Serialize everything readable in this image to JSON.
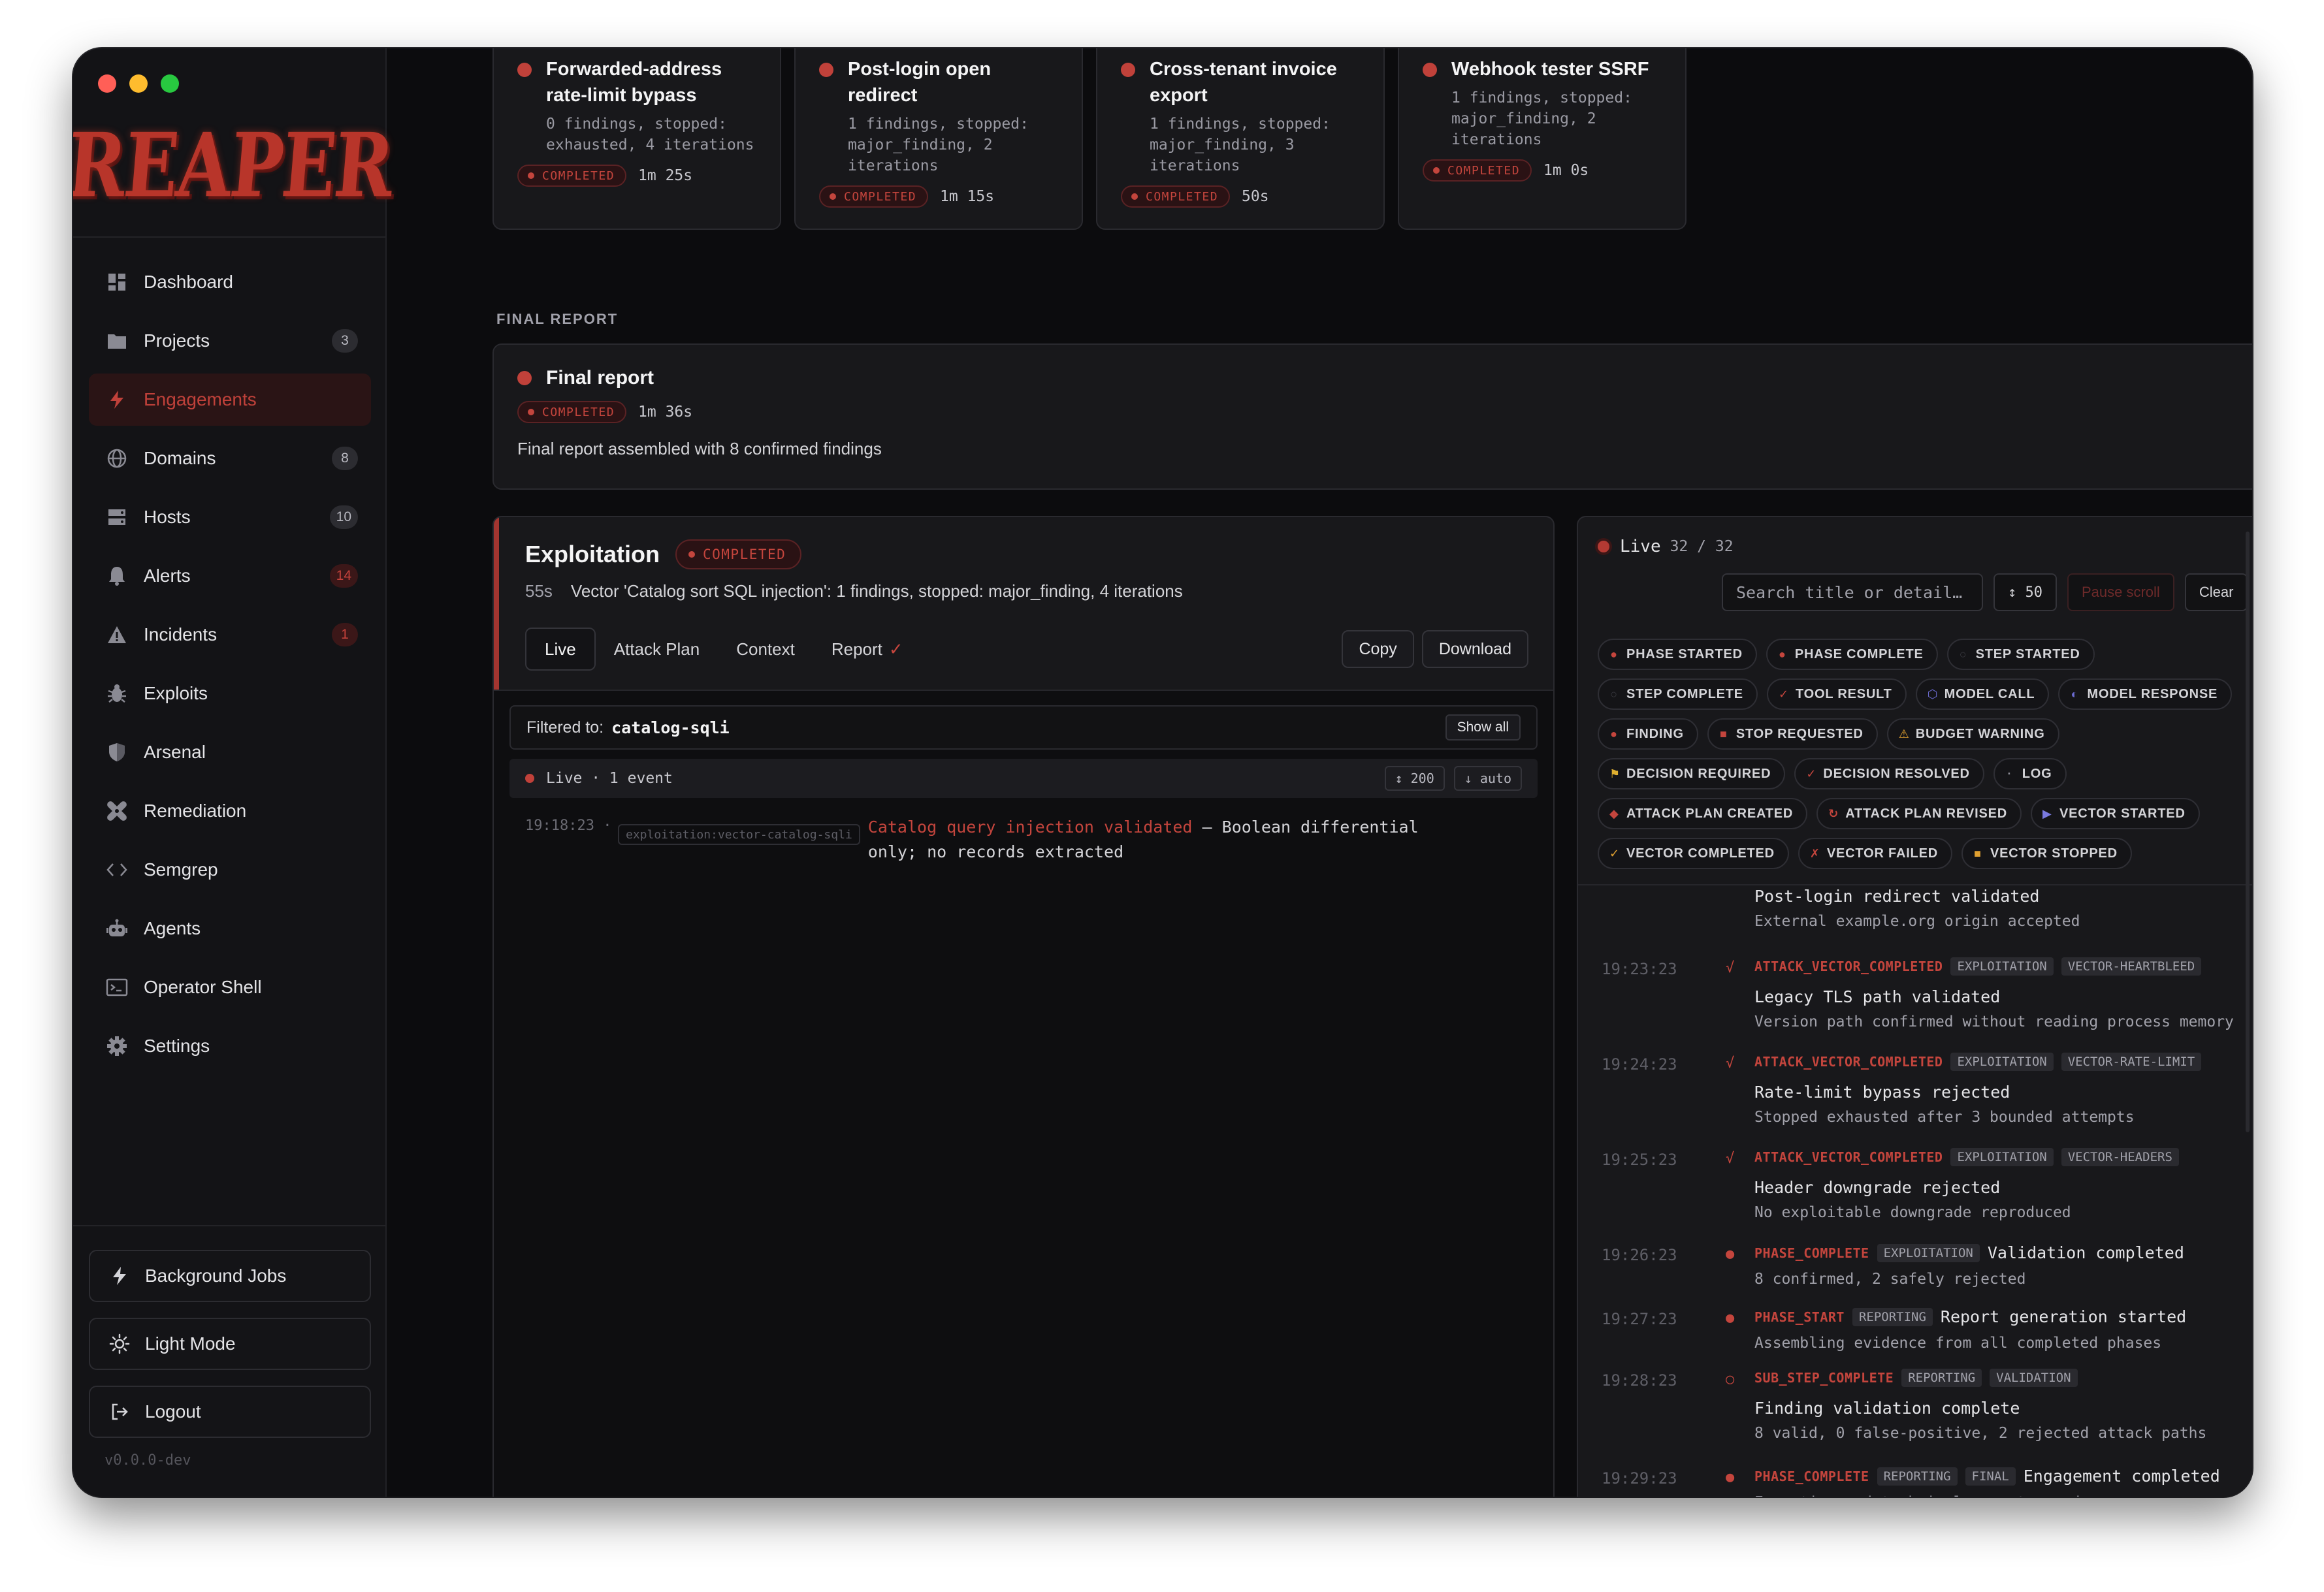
{
  "window": {
    "traffic_colors": [
      "#ff5f57",
      "#febc2e",
      "#28c840"
    ]
  },
  "sidebar": {
    "logo": "REAPER",
    "items": [
      {
        "label": "Dashboard",
        "icon": "grid-icon",
        "badge": ""
      },
      {
        "label": "Projects",
        "icon": "folder-icon",
        "badge": "3"
      },
      {
        "label": "Engagements",
        "icon": "bolt-icon",
        "badge": ""
      },
      {
        "label": "Domains",
        "icon": "globe-icon",
        "badge": "8"
      },
      {
        "label": "Hosts",
        "icon": "server-icon",
        "badge": "10"
      },
      {
        "label": "Alerts",
        "icon": "bell-icon",
        "badge": "14"
      },
      {
        "label": "Incidents",
        "icon": "warning-icon",
        "badge": "1"
      },
      {
        "label": "Exploits",
        "icon": "bug-icon",
        "badge": ""
      },
      {
        "label": "Arsenal",
        "icon": "shield-icon",
        "badge": ""
      },
      {
        "label": "Remediation",
        "icon": "bandage-icon",
        "badge": ""
      },
      {
        "label": "Semgrep",
        "icon": "code-icon",
        "badge": ""
      },
      {
        "label": "Agents",
        "icon": "robot-icon",
        "badge": ""
      },
      {
        "label": "Operator Shell",
        "icon": "terminal-icon",
        "badge": ""
      },
      {
        "label": "Settings",
        "icon": "gear-icon",
        "badge": ""
      }
    ],
    "active": "Engagements",
    "background_jobs": "Background Jobs",
    "light_mode": "Light Mode",
    "logout": "Logout",
    "version": "v0.0.0-dev"
  },
  "vector_cards": [
    {
      "title_1": "Forwarded-address",
      "title_2": "rate-limit bypass",
      "sub_1": "0 findings, stopped:",
      "sub_2": "exhausted, 4 iterations",
      "sub_3": "",
      "status": "COMPLETED",
      "duration": "1m 25s"
    },
    {
      "title_1": "Post-login open",
      "title_2": "redirect",
      "sub_1": "1 findings, stopped:",
      "sub_2": "major_finding, 2",
      "sub_3": "iterations",
      "status": "COMPLETED",
      "duration": "1m 15s"
    },
    {
      "title_1": "Cross-tenant invoice",
      "title_2": "export",
      "sub_1": "1 findings, stopped:",
      "sub_2": "major_finding, 3",
      "sub_3": "iterations",
      "status": "COMPLETED",
      "duration": "50s"
    },
    {
      "title_1": "Webhook tester SSRF",
      "title_2": "",
      "sub_1": "1 findings, stopped:",
      "sub_2": "major_finding, 2",
      "sub_3": "iterations",
      "status": "COMPLETED",
      "duration": "1m 0s"
    }
  ],
  "final_report": {
    "section_label": "FINAL REPORT",
    "title": "Final report",
    "status": "COMPLETED",
    "duration": "1m 36s",
    "body": "Final report assembled with 8 confirmed findings"
  },
  "exploitation": {
    "title": "Exploitation",
    "status": "COMPLETED",
    "duration": "55s",
    "summary": "Vector 'Catalog sort SQL injection': 1 findings, stopped: major_finding, 4 iterations",
    "tabs": [
      "Live",
      "Attack Plan",
      "Context",
      "Report"
    ],
    "report_check": "✓",
    "copy": "Copy",
    "download": "Download",
    "filter_label": "Filtered to:",
    "filter_value": "catalog-sqli",
    "show_all": "Show all",
    "live_label": "Live · 1 event",
    "limit": "↕ 200",
    "auto": "↓ auto",
    "event": {
      "time": "19:18:23 ·",
      "tag": "exploitation:vector-catalog-sqli",
      "highlight": "Catalog query injection validated",
      "line1_rest": " — Boolean differential",
      "line2": "only; no records extracted"
    }
  },
  "live_panel": {
    "label": "Live",
    "count": "32 / 32",
    "search_placeholder": "Search title or detail…",
    "limit": "↕ 50",
    "pause": "Pause scroll",
    "clear": "Clear",
    "chips": [
      [
        {
          "icon": "●",
          "label": "PHASE STARTED",
          "color": "#c4453d"
        },
        {
          "icon": "●",
          "label": "PHASE COMPLETE",
          "color": "#c4453d"
        },
        {
          "icon": "○",
          "label": "STEP STARTED",
          "color": "#3a3a40"
        }
      ],
      [
        {
          "icon": "○",
          "label": "STEP COMPLETE",
          "color": "#3a3a40"
        },
        {
          "icon": "✓",
          "label": "TOOL RESULT",
          "color": "#c4453d"
        },
        {
          "icon": "⬡",
          "label": "MODEL CALL",
          "color": "#6b6bd0"
        },
        {
          "icon": "◐",
          "label": "MODEL RESPONSE",
          "color": "#6b6bd0"
        }
      ],
      [
        {
          "icon": "●",
          "label": "FINDING",
          "color": "#c4453d"
        },
        {
          "icon": "■",
          "label": "STOP REQUESTED",
          "color": "#c4453d"
        },
        {
          "icon": "⚠",
          "label": "BUDGET WARNING",
          "color": "#e0a030"
        }
      ],
      [
        {
          "icon": "⚑",
          "label": "DECISION REQUIRED",
          "color": "#e0b030"
        },
        {
          "icon": "✓",
          "label": "DECISION RESOLVED",
          "color": "#c4453d"
        },
        {
          "icon": "·",
          "label": "LOG",
          "color": "#8a8a93"
        }
      ],
      [
        {
          "icon": "◆",
          "label": "ATTACK PLAN CREATED",
          "color": "#c4453d"
        },
        {
          "icon": "↻",
          "label": "ATTACK PLAN REVISED",
          "color": "#c4453d"
        },
        {
          "icon": "▶",
          "label": "VECTOR STARTED",
          "color": "#7a7ae0"
        }
      ],
      [
        {
          "icon": "✓",
          "label": "VECTOR COMPLETED",
          "color": "#e0a030"
        },
        {
          "icon": "✗",
          "label": "VECTOR FAILED",
          "color": "#c4453d"
        },
        {
          "icon": "■",
          "label": "VECTOR STOPPED",
          "color": "#e0a030"
        }
      ]
    ],
    "events": [
      {
        "time": "",
        "icon": "",
        "type": "",
        "tags": [],
        "title": "",
        "line2": "Post-login redirect validated",
        "desc": "External example.org origin accepted"
      },
      {
        "time": "19:23:23",
        "icon": "√",
        "type": "ATTACK_VECTOR_COMPLETED",
        "tags": [
          "EXPLOITATION",
          "VECTOR-HEARTBLEED"
        ],
        "title": "",
        "line2": "Legacy TLS path validated",
        "desc": "Version path confirmed without reading process memory"
      },
      {
        "time": "19:24:23",
        "icon": "√",
        "type": "ATTACK_VECTOR_COMPLETED",
        "tags": [
          "EXPLOITATION",
          "VECTOR-RATE-LIMIT"
        ],
        "title": "",
        "line2": "Rate-limit bypass rejected",
        "desc": "Stopped exhausted after 3 bounded attempts"
      },
      {
        "time": "19:25:23",
        "icon": "√",
        "type": "ATTACK_VECTOR_COMPLETED",
        "tags": [
          "EXPLOITATION",
          "VECTOR-HEADERS"
        ],
        "title": "",
        "line2": "Header downgrade rejected",
        "desc": "No exploitable downgrade reproduced"
      },
      {
        "time": "19:26:23",
        "icon": "●",
        "type": "PHASE_COMPLETE",
        "tags": [
          "EXPLOITATION"
        ],
        "title": "Validation completed",
        "line2": "",
        "desc": "8 confirmed, 2 safely rejected"
      },
      {
        "time": "19:27:23",
        "icon": "●",
        "type": "PHASE_START",
        "tags": [
          "REPORTING"
        ],
        "title": "Report generation started",
        "line2": "",
        "desc": "Assembling evidence from all completed phases"
      },
      {
        "time": "19:28:23",
        "icon": "○",
        "type": "SUB_STEP_COMPLETE",
        "tags": [
          "REPORTING",
          "VALIDATION"
        ],
        "title": "",
        "line2": "Finding validation complete",
        "desc": "8 valid, 0 false-positive, 2 rejected attack paths"
      },
      {
        "time": "19:29:23",
        "icon": "●",
        "type": "PHASE_COMPLETE",
        "tags": [
          "REPORTING",
          "FINAL"
        ],
        "title": "Engagement completed",
        "line2": "",
        "desc": "Executive and technical reports ready"
      }
    ]
  }
}
